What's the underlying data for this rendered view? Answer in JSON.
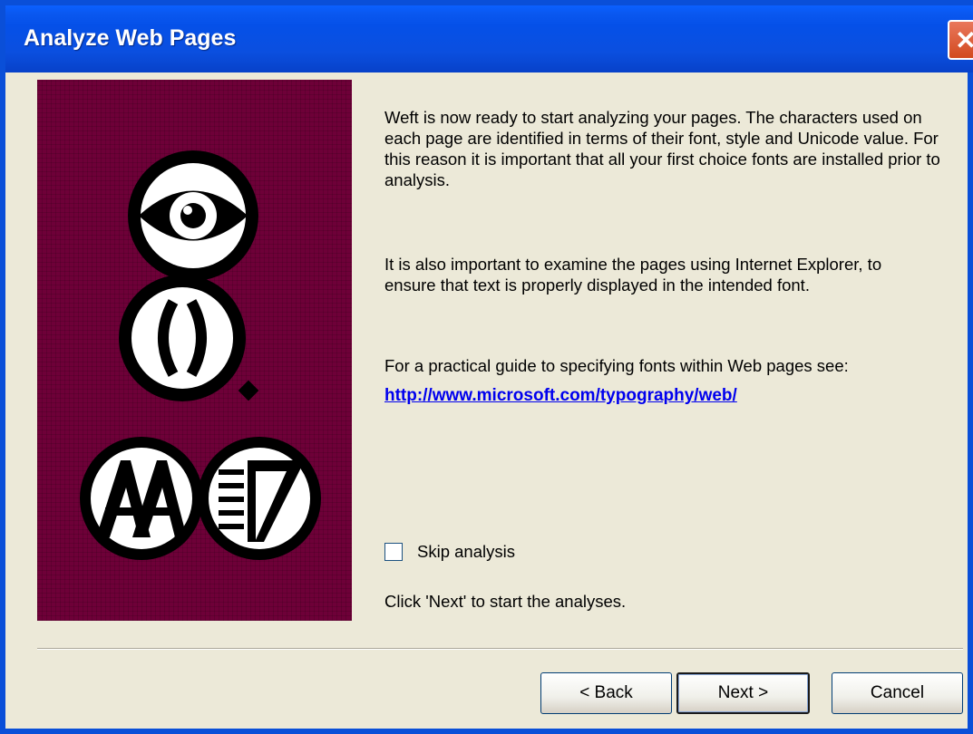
{
  "window": {
    "title": "Analyze Web Pages",
    "close_label": "✕"
  },
  "content": {
    "para1": "Weft is now ready to start analyzing your pages. The characters used on each page are identified in terms of their font, style and Unicode value. For this reason it is important that all your first choice fonts are installed prior to analysis.",
    "para2": "It is also important to examine the pages using Internet Explorer, to ensure that text is properly displayed in the intended font.",
    "para3": "For a practical guide to specifying fonts within Web pages see:",
    "link": "http://www.microsoft.com/typography/web/",
    "skip_label": "Skip analysis",
    "skip_checked": false,
    "click_next": "Click 'Next' to start the analyses."
  },
  "buttons": {
    "back": "< Back",
    "next": "Next >",
    "cancel": "Cancel"
  },
  "colors": {
    "titlebar": "#0a58f0",
    "side_panel": "#6e0038",
    "link": "#0000ee"
  }
}
